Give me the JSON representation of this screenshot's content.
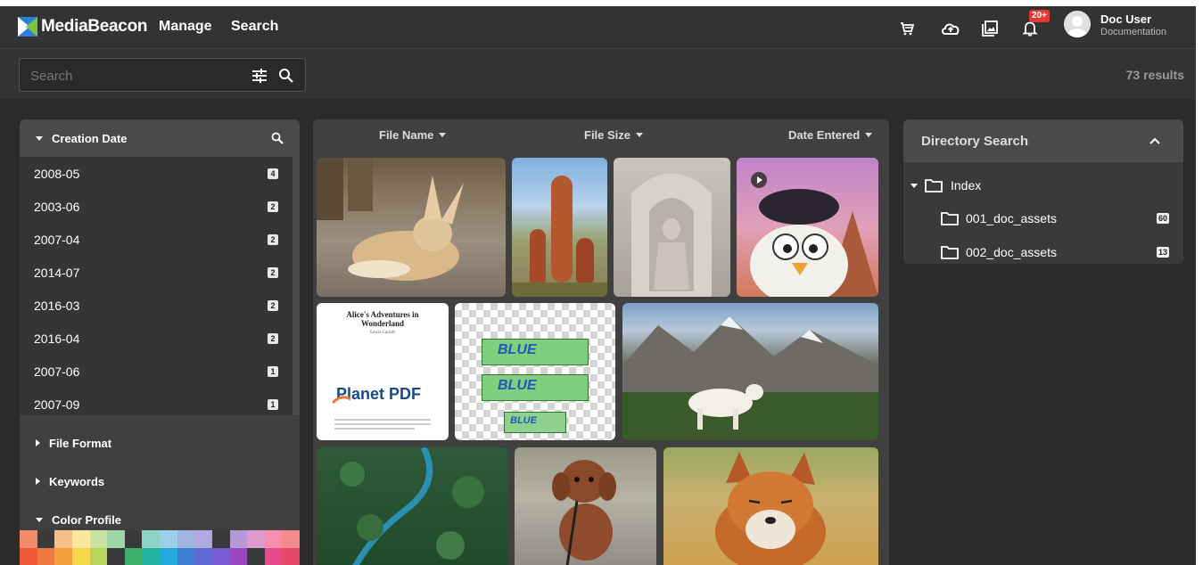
{
  "app": {
    "brand": "MediaBeacon"
  },
  "nav": {
    "manage": "Manage",
    "search": "Search"
  },
  "header": {
    "icons": [
      "cart-icon",
      "upload-cloud-icon",
      "gallery-icon",
      "bell-icon"
    ],
    "notification_badge": "20+",
    "user_name": "Doc User",
    "user_org": "Documentation"
  },
  "search": {
    "placeholder": "Search",
    "results": "73 results"
  },
  "facets": {
    "creation_date": "Creation Date",
    "dates": [
      {
        "label": "2008-05",
        "count": "4"
      },
      {
        "label": "2003-06",
        "count": "2"
      },
      {
        "label": "2007-04",
        "count": "2"
      },
      {
        "label": "2014-07",
        "count": "2"
      },
      {
        "label": "2016-03",
        "count": "2"
      },
      {
        "label": "2016-04",
        "count": "2"
      },
      {
        "label": "2007-06",
        "count": "1"
      },
      {
        "label": "2007-09",
        "count": "1"
      }
    ],
    "file_format": "File Format",
    "keywords": "Keywords",
    "color_profile": "Color Profile",
    "swatch_colors_top": [
      "#f28a6b",
      "#3a3a3a",
      "#f7c08a",
      "#f9e79f",
      "#c9e3a0",
      "#9fd6a5",
      "#3a3a3a",
      "#8fd3c6",
      "#9bd0e8",
      "#9fb4e0",
      "#b0a8e0",
      "#3a3a3a",
      "#b598d6",
      "#e09ad0",
      "#f58fb0",
      "#f58a8a"
    ],
    "swatch_colors_bottom": [
      "#ef5a3a",
      "#f07840",
      "#f4a040",
      "#f5d94a",
      "#b9d65a",
      "#3a3a3a",
      "#3bb06a",
      "#22b3a0",
      "#22a9d8",
      "#3a7fd0",
      "#5a6ad0",
      "#7a5ad0",
      "#9a48c0",
      "#3a3a3a",
      "#e84a90",
      "#e8486a"
    ]
  },
  "grid": {
    "sort_file_name": "File Name",
    "sort_file_size": "File Size",
    "sort_date_entered": "Date Entered",
    "pdf_title": "Alice's Adventures in Wonderland",
    "pdf_author": "Lewis Carroll",
    "pdf_brand": "Planet PDF",
    "box_brand": "BLUE"
  },
  "directory": {
    "title": "Directory Search",
    "root": "Index",
    "folders": [
      {
        "name": "001_doc_assets",
        "count": "60"
      },
      {
        "name": "002_doc_assets",
        "count": "13"
      }
    ]
  }
}
